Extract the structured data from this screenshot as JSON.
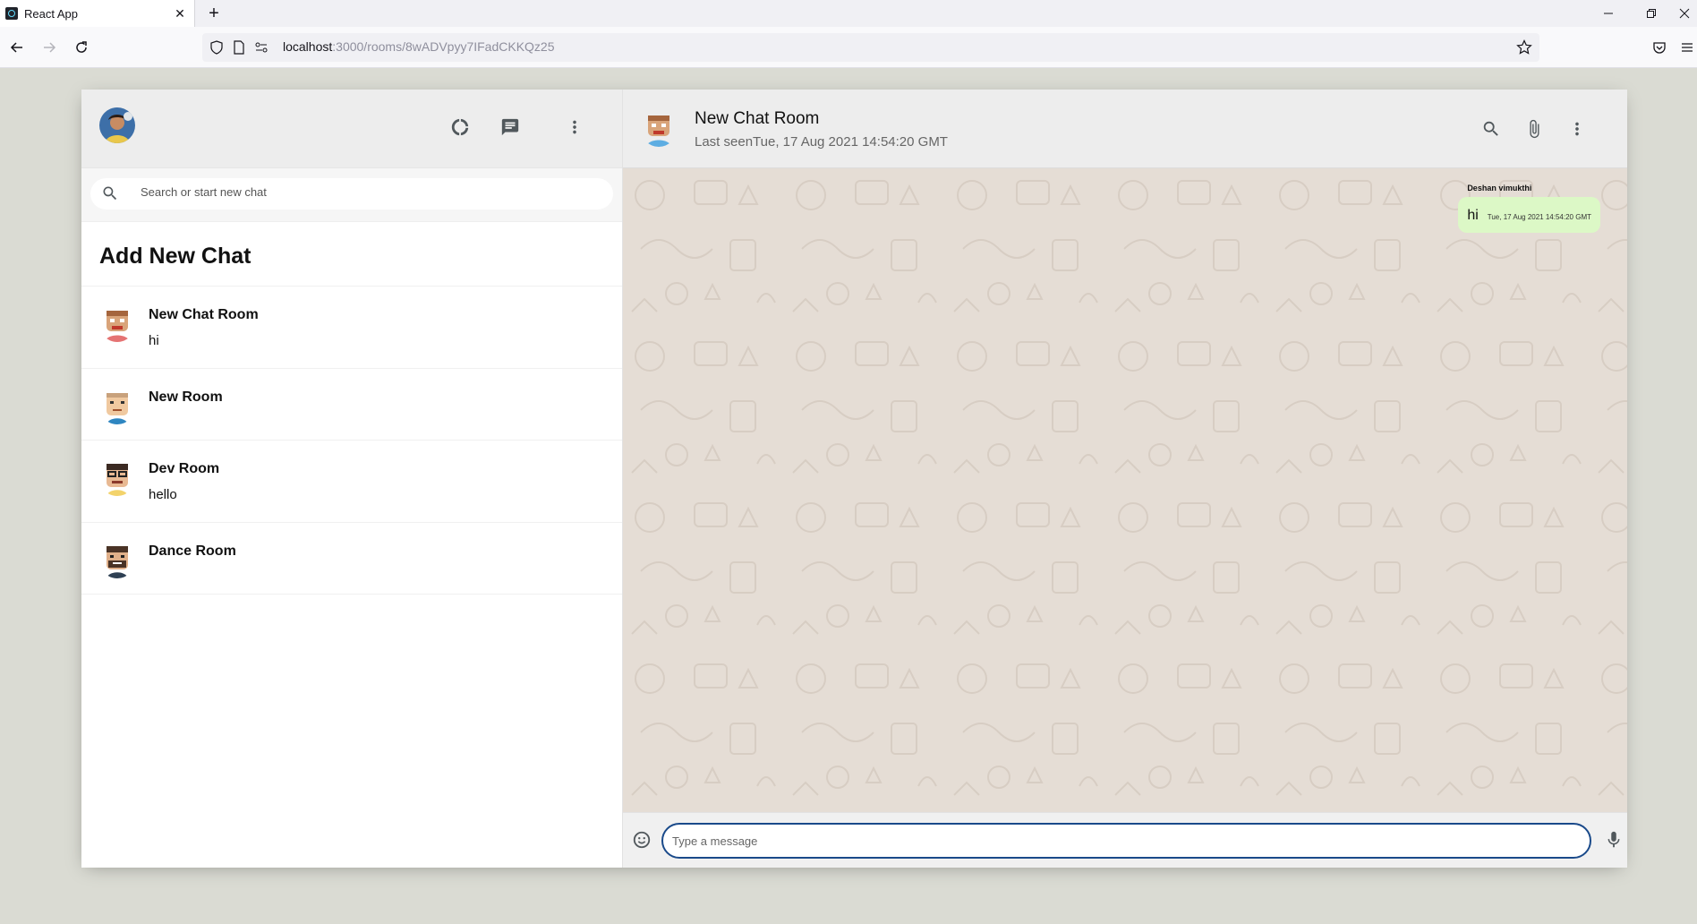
{
  "browser": {
    "tab_title": "React App",
    "url_host": "localhost",
    "url_path": ":3000/rooms/8wADVpyy7IFadCKKQz25"
  },
  "sidebar": {
    "search_placeholder": "Search or start new chat",
    "add_new_chat": "Add New Chat",
    "rooms": [
      {
        "name": "New Chat Room",
        "last_message": "hi"
      },
      {
        "name": "New Room",
        "last_message": ""
      },
      {
        "name": "Dev Room",
        "last_message": "hello"
      },
      {
        "name": "Dance Room",
        "last_message": ""
      }
    ]
  },
  "chat": {
    "title": "New Chat Room",
    "last_seen": "Last seenTue, 17 Aug 2021 14:54:20 GMT",
    "messages": [
      {
        "sender": "Deshan vimukthi",
        "text": "hi",
        "time": "Tue, 17 Aug 2021 14:54:20 GMT"
      }
    ],
    "input_placeholder": "Type a message"
  },
  "icons": {
    "header": [
      "donut-large-icon",
      "chat-icon",
      "more-vert-icon"
    ],
    "chat_header": [
      "search-icon",
      "attach-file-icon",
      "more-vert-icon"
    ],
    "footer": [
      "emoji-icon",
      "mic-icon"
    ]
  },
  "colors": {
    "background": "#dadbd3",
    "header": "#ededed",
    "chat_background": "#e5ddd5",
    "sent_bubble": "#dcf8c6",
    "input_focus": "#1a4a8a"
  }
}
